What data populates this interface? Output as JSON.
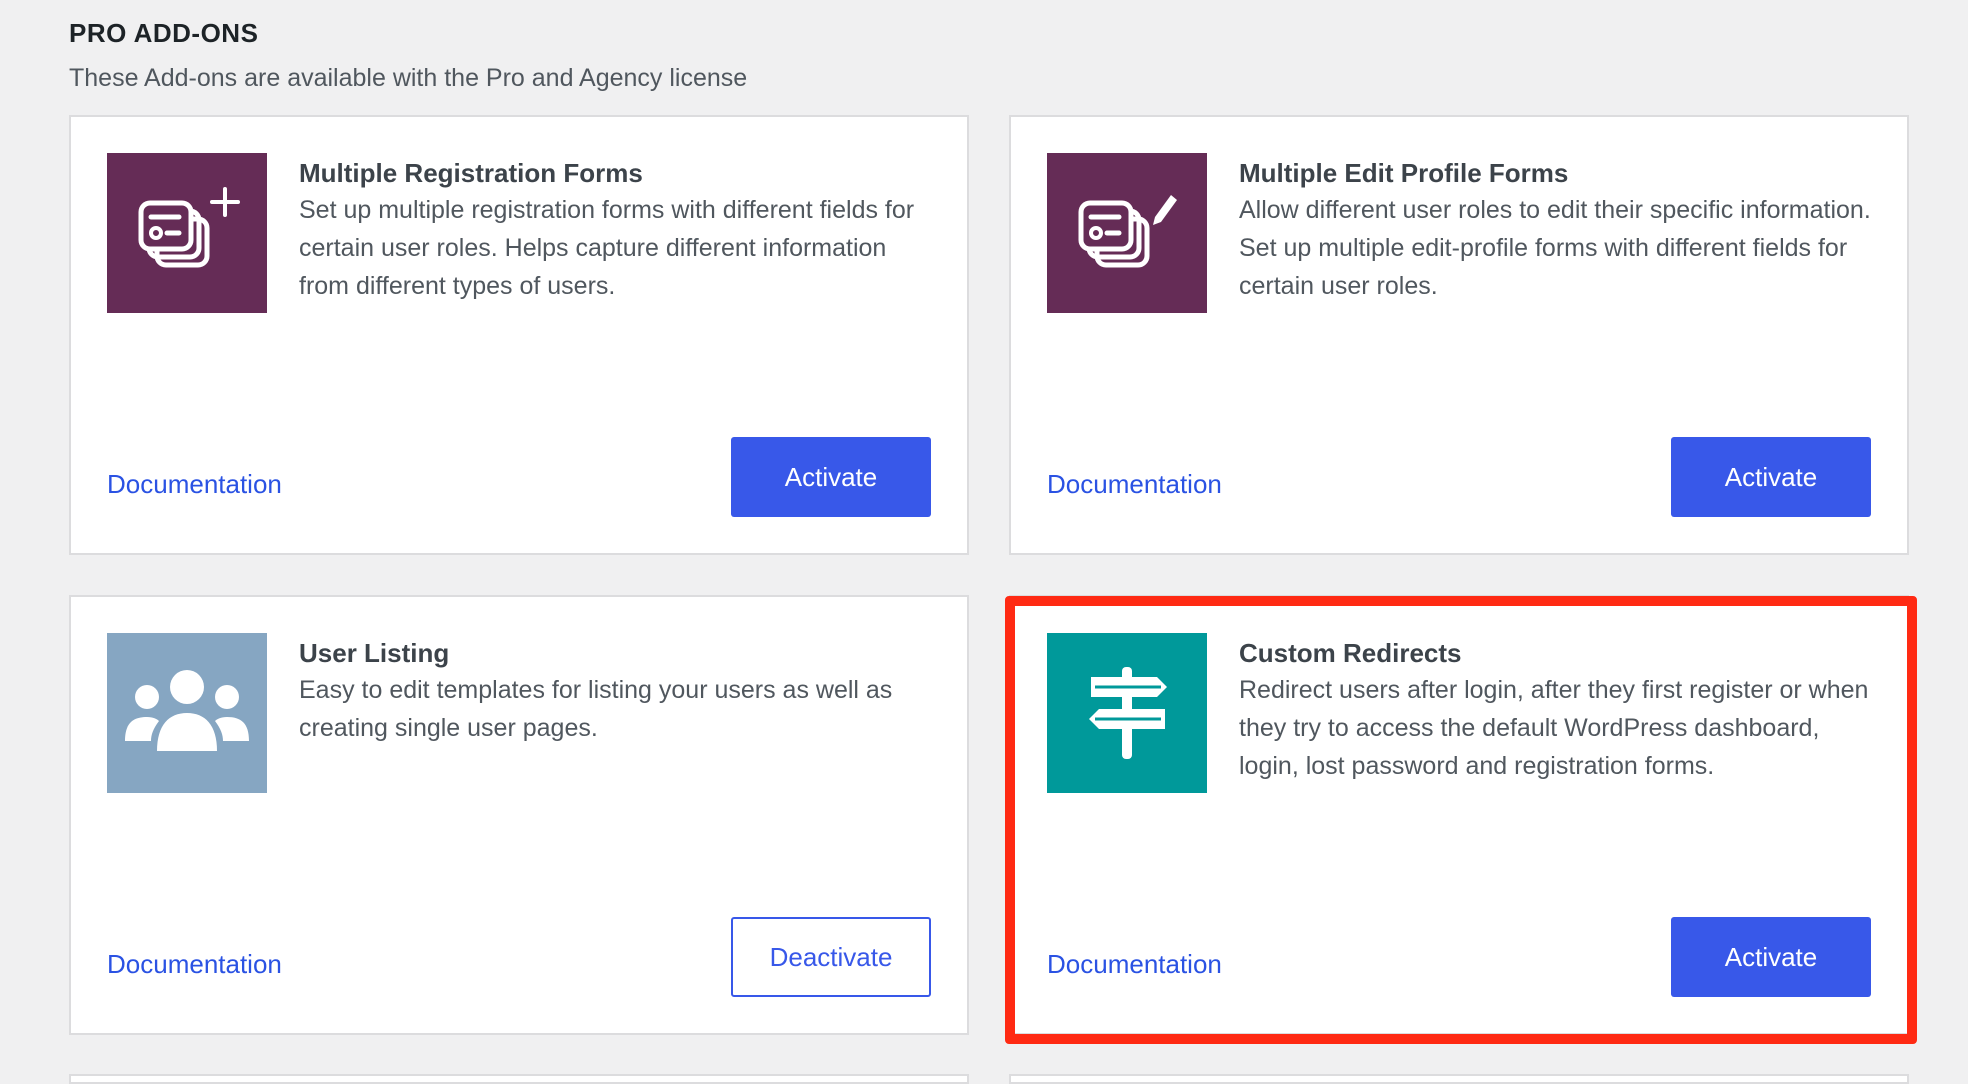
{
  "section": {
    "title": "PRO ADD-ONS",
    "subtitle": "These Add-ons are available with the Pro and Agency license"
  },
  "cards": [
    {
      "title": "Multiple Registration Forms",
      "description": "Set up multiple registration forms with different fields for certain user roles. Helps capture different information from different types of users.",
      "icon": "registration-form-plus-icon",
      "icon_bg": "#652c56",
      "doc_label": "Documentation",
      "button_label": "Activate",
      "button_style": "primary"
    },
    {
      "title": "Multiple Edit Profile Forms",
      "description": "Allow different user roles to edit their specific information. Set up multiple edit-profile forms with different fields for certain user roles.",
      "icon": "edit-profile-form-pencil-icon",
      "icon_bg": "#652c56",
      "doc_label": "Documentation",
      "button_label": "Activate",
      "button_style": "primary"
    },
    {
      "title": "User Listing",
      "description": "Easy to edit templates for listing your users as well as creating single user pages.",
      "icon": "user-group-icon",
      "icon_bg": "#86a6c2",
      "doc_label": "Documentation",
      "button_label": "Deactivate",
      "button_style": "secondary"
    },
    {
      "title": "Custom Redirects",
      "description": "Redirect users after login, after they first register or when they try to access the default WordPress dashboard, login, lost password and registration forms.",
      "icon": "signpost-icon",
      "icon_bg": "#00999a",
      "doc_label": "Documentation",
      "button_label": "Activate",
      "button_style": "primary"
    }
  ],
  "colors": {
    "page_bg": "#f0f0f1",
    "card_border": "#dcdcde",
    "link": "#2a52e3",
    "primary_button": "#3858e9",
    "highlight": "#ff2a13"
  }
}
